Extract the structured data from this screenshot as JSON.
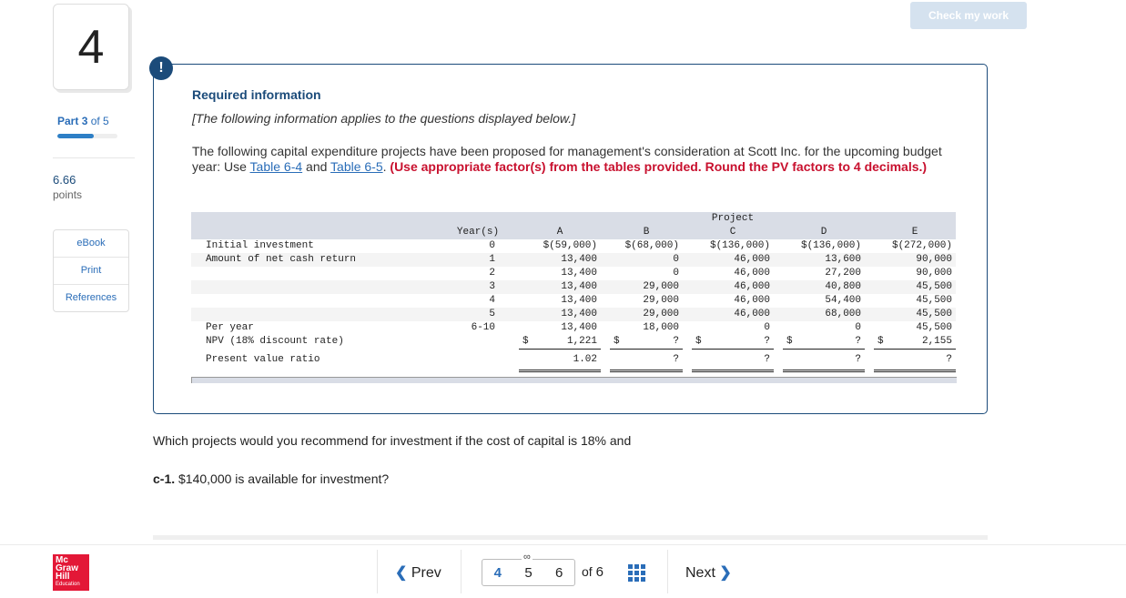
{
  "question": {
    "number": "4",
    "part_label": "Part",
    "part_current": "3",
    "part_of": "of 5",
    "part_progress": 0.6,
    "points_value": "6.66",
    "points_label": "points"
  },
  "side_links": [
    "eBook",
    "Print",
    "References"
  ],
  "header": {
    "check_button": "Check my work"
  },
  "info": {
    "alert_icon": "!",
    "title": "Required information",
    "note": "[The following information applies to the questions displayed below.]",
    "body_pre": "The following capital expenditure projects have been proposed for management's consideration at Scott Inc. for the upcoming budget year: Use ",
    "link1": "Table 6-4",
    "body_mid": " and ",
    "link2": "Table 6-5",
    "body_post": ". ",
    "instruction": "(Use appropriate factor(s) from the tables provided. Round the PV factors to 4 decimals.)"
  },
  "table": {
    "group_header": "Project",
    "year_header": "Year(s)",
    "projects": [
      "A",
      "B",
      "C",
      "D",
      "E"
    ],
    "rows": [
      {
        "label": "Initial investment",
        "year": "0",
        "values": [
          "$(59,000)",
          "$(68,000)",
          "$(136,000)",
          "$(136,000)",
          "$(272,000)"
        ]
      },
      {
        "label": "Amount of net cash return",
        "year": "1",
        "values": [
          "13,400",
          "0",
          "46,000",
          "13,600",
          "90,000"
        ]
      },
      {
        "label": "",
        "year": "2",
        "values": [
          "13,400",
          "0",
          "46,000",
          "27,200",
          "90,000"
        ]
      },
      {
        "label": "",
        "year": "3",
        "values": [
          "13,400",
          "29,000",
          "46,000",
          "40,800",
          "45,500"
        ]
      },
      {
        "label": "",
        "year": "4",
        "values": [
          "13,400",
          "29,000",
          "46,000",
          "54,400",
          "45,500"
        ]
      },
      {
        "label": "",
        "year": "5",
        "values": [
          "13,400",
          "29,000",
          "46,000",
          "68,000",
          "45,500"
        ]
      },
      {
        "label": "Per year",
        "year": "6-10",
        "values": [
          "13,400",
          "18,000",
          "0",
          "0",
          "45,500"
        ]
      }
    ],
    "npv": {
      "label": "NPV (18% discount rate)",
      "currency": "$",
      "values": [
        "1,221",
        "?",
        "?",
        "?",
        "2,155"
      ]
    },
    "pv_ratio": {
      "label": "Present value ratio",
      "values": [
        "1.02",
        "?",
        "?",
        "?",
        "?"
      ]
    }
  },
  "prompt": {
    "question": "Which projects would you recommend for investment if the cost of capital is 18% and",
    "sub_label": "c-1.",
    "sub_text": " $140,000 is available for investment?"
  },
  "footer": {
    "logo_lines": [
      "Mc",
      "Graw",
      "Hill",
      "Education"
    ],
    "prev": "Prev",
    "pages": [
      "4",
      "5",
      "6"
    ],
    "current_page": "4",
    "of_label": "of",
    "total_pages": "6",
    "next": "Next"
  }
}
